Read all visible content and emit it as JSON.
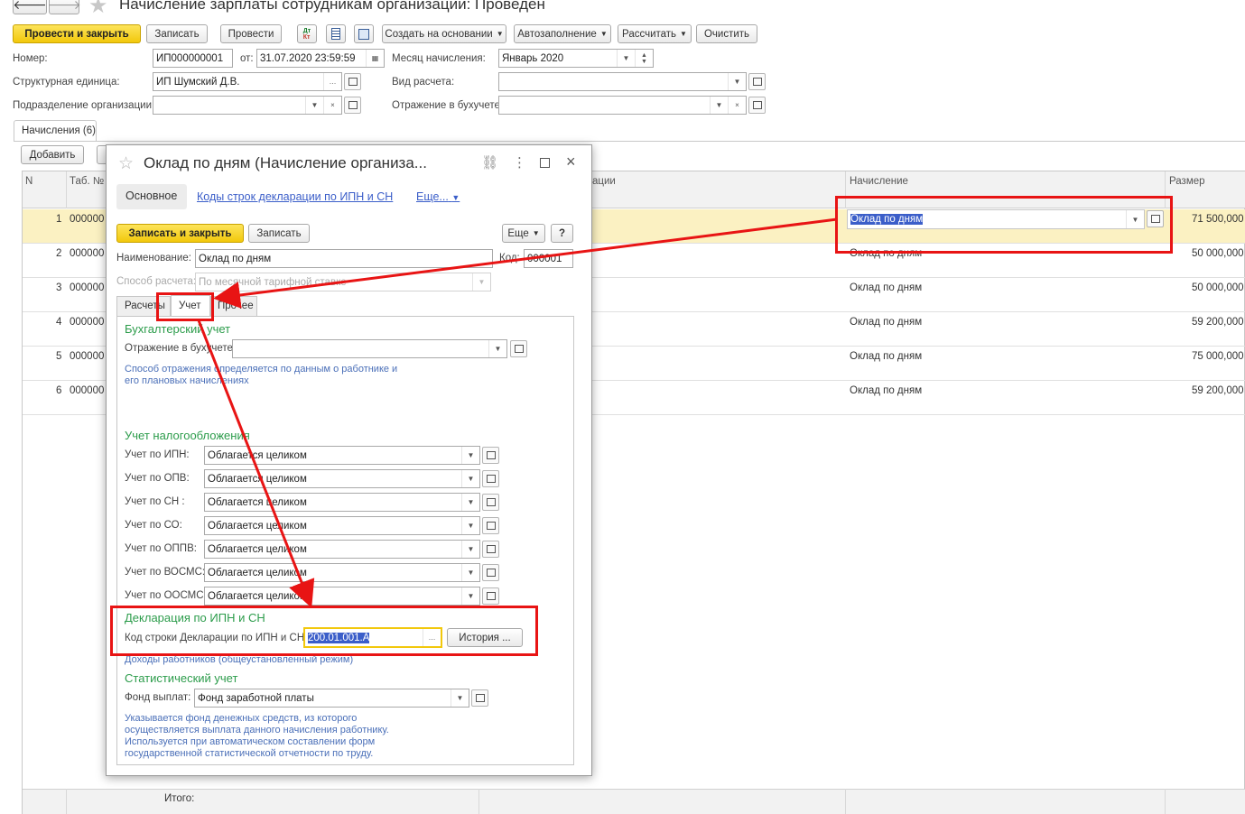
{
  "window": {
    "title": "Начисление зарплаты сотрудникам организации: Проведен"
  },
  "toolbar": {
    "post_close": "Провести и закрыть",
    "save": "Записать",
    "post": "Провести",
    "create_based": "Создать на основании",
    "autofill": "Автозаполнение",
    "calculate": "Рассчитать",
    "clear": "Очистить"
  },
  "header": {
    "number_label": "Номер:",
    "number_value": "ИП000000001",
    "date_label": "от:",
    "date_value": "31.07.2020 23:59:59",
    "month_label": "Месяц начисления:",
    "month_value": "Январь 2020",
    "unit_label": "Структурная единица:",
    "unit_value": "ИП Шумский Д.В.",
    "calc_type_label": "Вид расчета:",
    "calc_type_value": "",
    "dept_label": "Подразделение организации:",
    "dept_value": "",
    "accounting_label": "Отражение в бухучете:",
    "accounting_value": ""
  },
  "tabs": {
    "accruals": "Начисления (6)"
  },
  "grid": {
    "add_button": "Добавить",
    "col_n": "N",
    "col_tab": "Таб. №",
    "col_emp": "...ации",
    "col_accrual": "Начисление",
    "col_size": "Размер",
    "footer_total": "Итого:",
    "rows": [
      {
        "n": "1",
        "tab": "000000",
        "accrual": "Оклад по дням",
        "size": "71 500,000"
      },
      {
        "n": "2",
        "tab": "000000",
        "accrual": "Оклад по дням",
        "size": "50 000,000"
      },
      {
        "n": "3",
        "tab": "000000",
        "accrual": "Оклад по дням",
        "size": "50 000,000"
      },
      {
        "n": "4",
        "tab": "000000",
        "accrual": "Оклад по дням",
        "size": "59 200,000"
      },
      {
        "n": "5",
        "tab": "000000",
        "accrual": "Оклад по дням",
        "size": "75 000,000"
      },
      {
        "n": "6",
        "tab": "000000",
        "accrual": "Оклад по дням",
        "size": "59 200,000"
      }
    ]
  },
  "dialog": {
    "title": "Оклад по дням (Начисление организа...",
    "nav_main": "Основное",
    "nav_codes": "Коды строк декларации по ИПН и СН",
    "nav_more": "Еще...",
    "save_close": "Записать и закрыть",
    "save": "Записать",
    "more": "Еще",
    "help": "?",
    "name_label": "Наименование:",
    "name_value": "Оклад по дням",
    "code_label": "Код:",
    "code_value": "000001",
    "method_label": "Способ расчета:",
    "method_value": "По месячной тарифной ставке",
    "tab_calc": "Расчеты",
    "tab_account": "Учет",
    "tab_other": "Прочее",
    "section_acc": "Бухгалтерский учет",
    "acc_reflect_label": "Отражение в бухучете:",
    "acc_reflect_value": "",
    "acc_note_1": "Способ отражения определяется по данным о работнике и",
    "acc_note_2": "его плановых начислениях",
    "section_tax": "Учет налогообложения",
    "tax_rows": [
      {
        "label": "Учет по ИПН:",
        "value": "Облагается целиком"
      },
      {
        "label": "Учет по ОПВ:",
        "value": "Облагается целиком"
      },
      {
        "label": "Учет по СН :",
        "value": "Облагается целиком"
      },
      {
        "label": "Учет по СО:",
        "value": "Облагается целиком"
      },
      {
        "label": "Учет по ОППВ:",
        "value": "Облагается целиком"
      },
      {
        "label": "Учет по ВОСМС:",
        "value": "Облагается целиком"
      },
      {
        "label": "Учет по ООСМС:",
        "value": "Облагается целиком"
      }
    ],
    "section_decl": "Декларация по ИПН и СН",
    "decl_label": "Код строки Декларации по ИПН и СН:",
    "decl_value": "200.01.001.A",
    "history": "История ...",
    "decl_note": "Доходы работников (общеустановленный режим)",
    "section_stat": "Статистический учет",
    "fund_label": "Фонд выплат:",
    "fund_value": "Фонд заработной платы",
    "stat_note_1": "Указывается фонд денежных средств, из которого",
    "stat_note_2": "осуществляется выплата данного начисления работнику.",
    "stat_note_3": "Используется при автоматическом составлении форм",
    "stat_note_4": "государственной статистической отчетности по труду."
  },
  "colors": {
    "accent_yellow": "#f2c80c",
    "highlight_red": "#e81414",
    "section_green": "#2c9c4b",
    "note_blue": "#4a6fb8"
  }
}
